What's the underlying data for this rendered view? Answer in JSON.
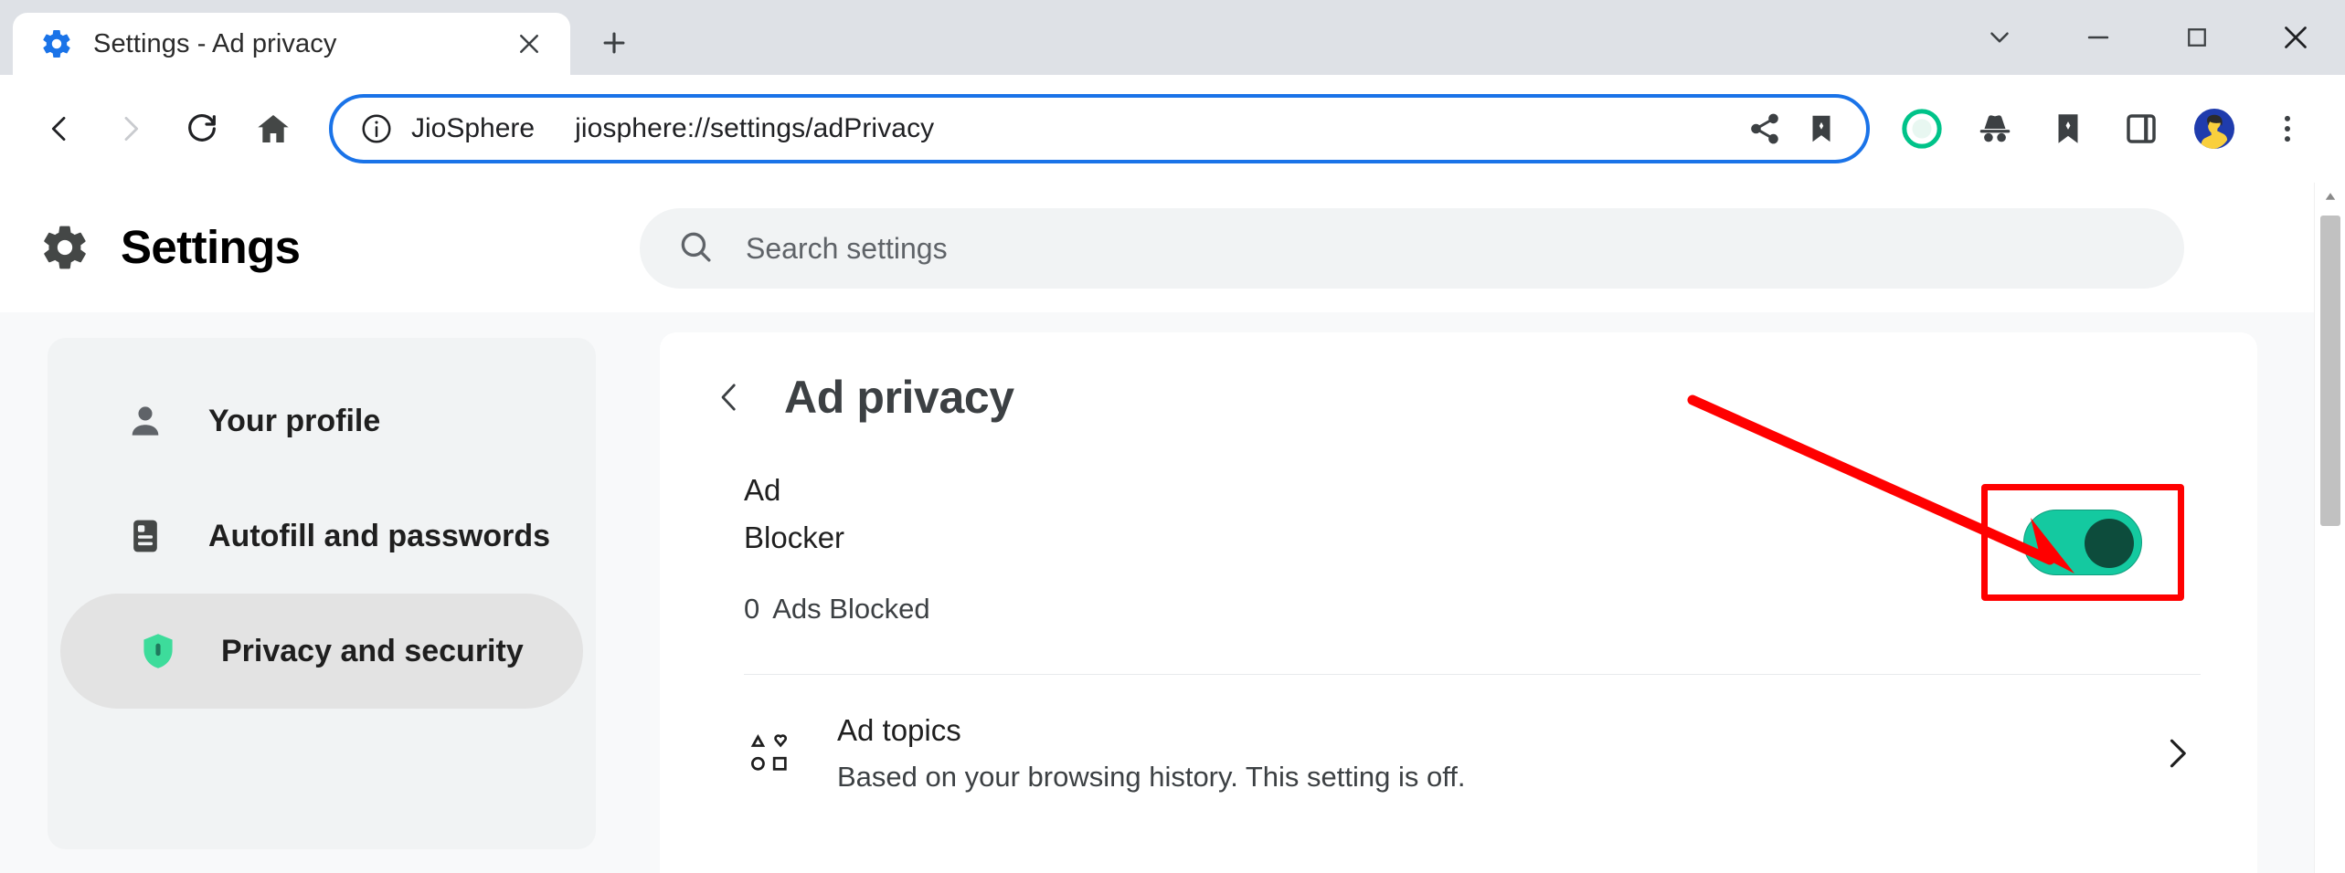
{
  "window": {
    "controls": [
      {
        "name": "tab-search",
        "icon": "chevron-down-icon"
      },
      {
        "name": "minimize",
        "icon": "minimize-icon"
      },
      {
        "name": "maximize",
        "icon": "maximize-icon"
      },
      {
        "name": "close",
        "icon": "close-icon"
      }
    ]
  },
  "tab": {
    "title": "Settings - Ad privacy",
    "favicon": "gear-icon",
    "close_label": "✕",
    "new_tab_label": "+"
  },
  "toolbar": {
    "back": "‹",
    "forward": "›",
    "reload": "reload-icon",
    "home": "home-icon",
    "omnibox": {
      "origin": "JioSphere",
      "url": "jiosphere://settings/adPrivacy",
      "info_icon": "info-icon",
      "share_icon": "share-icon",
      "bookmark_icon": "bookmark-icon"
    },
    "actions": [
      {
        "name": "shield-extension-icon",
        "label": "shield"
      },
      {
        "name": "incognito-icon",
        "label": "incognito"
      },
      {
        "name": "bookmarks-icon",
        "label": "bookmarks"
      },
      {
        "name": "side-panel-icon",
        "label": "side panel"
      },
      {
        "name": "avatar",
        "label": "profile"
      },
      {
        "name": "more-menu-icon",
        "label": "⋮"
      }
    ]
  },
  "settings": {
    "title": "Settings",
    "gear_icon": "gear-icon",
    "search": {
      "placeholder": "Search settings",
      "icon": "search-icon",
      "value": ""
    }
  },
  "sidebar": {
    "items": [
      {
        "label": "Your profile",
        "icon": "person-icon",
        "selected": false
      },
      {
        "label": "Autofill and passwords",
        "icon": "document-icon",
        "selected": false
      },
      {
        "label": "Privacy and security",
        "icon": "shield-icon",
        "selected": true
      }
    ]
  },
  "main": {
    "back_icon": "chevron-left-icon",
    "title": "Ad privacy",
    "ad_blocker": {
      "label_line1": "Ad",
      "label_line2": "Blocker",
      "count": "0",
      "count_label": "Ads Blocked",
      "toggle_on": true,
      "toggle_state_text": "on"
    },
    "rows": [
      {
        "icon": "ad-topics-icon",
        "title": "Ad topics",
        "subtitle": "Based on your browsing history. This setting is off.",
        "chevron": "chevron-right-icon"
      }
    ]
  },
  "annotation": {
    "arrow_color": "#ff0000",
    "highlight_color": "#ff0000"
  },
  "colors": {
    "accent": "#1a73e8",
    "toggle_track": "#14c9a0",
    "toggle_knob": "#0d4c3c",
    "shield_teal": "#3ddc9b",
    "tabstrip": "#dee1e6",
    "page_bg": "#f8f9fa"
  }
}
